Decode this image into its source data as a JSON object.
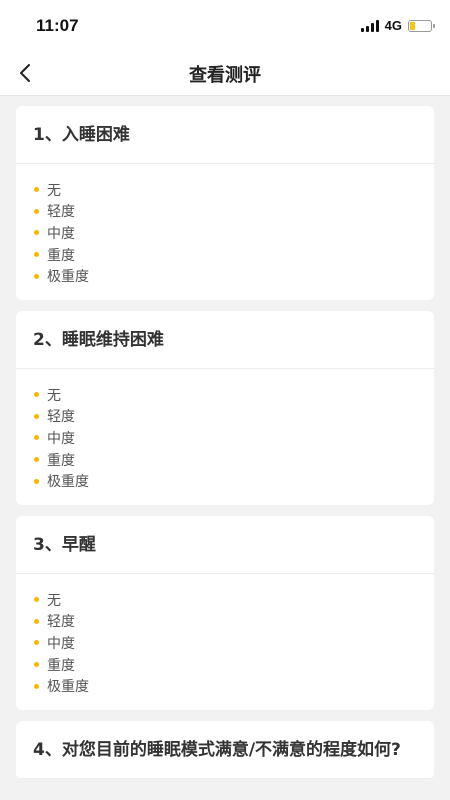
{
  "status": {
    "time": "11:07",
    "network": "4G",
    "battery_level": 0.25,
    "accent_color": "#f5c518"
  },
  "nav": {
    "title": "查看测评",
    "back_icon": "chevron-left-icon"
  },
  "questions": [
    {
      "title": "1、入睡困难",
      "options": [
        "无",
        "轻度",
        "中度",
        "重度",
        "极重度"
      ]
    },
    {
      "title": "2、睡眠维持困难",
      "options": [
        "无",
        "轻度",
        "中度",
        "重度",
        "极重度"
      ]
    },
    {
      "title": "3、早醒",
      "options": [
        "无",
        "轻度",
        "中度",
        "重度",
        "极重度"
      ]
    },
    {
      "title": "4、对您目前的睡眠模式满意/不满意的程度如何?",
      "options": []
    }
  ],
  "colors": {
    "bullet": "#f5b800",
    "background": "#f2f2f2",
    "card": "#ffffff"
  }
}
